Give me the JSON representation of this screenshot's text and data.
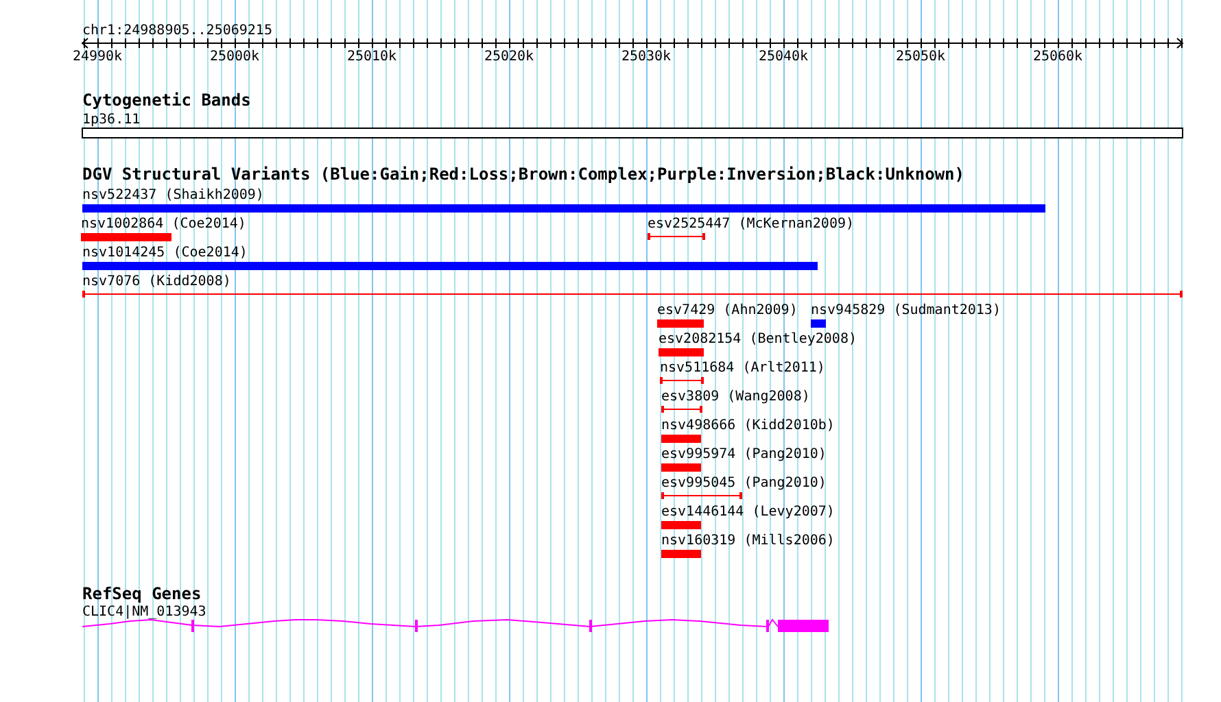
{
  "ruler": {
    "location": "chr1:24988905..25069215",
    "ticks": [
      "24990k",
      "25000k",
      "25010k",
      "25020k",
      "25030k",
      "25040k",
      "25050k",
      "25060k"
    ]
  },
  "tracks": [
    {
      "kind": "bands",
      "title": "Cytogenetic Bands",
      "features": [
        {
          "label": "1p36.11"
        }
      ]
    },
    {
      "kind": "variants",
      "title": "DGV Structural Variants (Blue:Gain;Red:Loss;Brown:Complex;Purple:Inversion;Black:Unknown)",
      "features": [
        {
          "label": "nsv522437 (Shaikh2009)",
          "kind": "gain",
          "thin": false
        },
        {
          "label": "nsv1002864 (Coe2014)",
          "kind": "loss",
          "thin": false
        },
        {
          "label": "esv2525447 (McKernan2009)",
          "kind": "loss",
          "thin": true
        },
        {
          "label": "nsv1014245 (Coe2014)",
          "kind": "gain",
          "thin": false
        },
        {
          "label": "nsv7076 (Kidd2008)",
          "kind": "loss",
          "thin": true
        },
        {
          "label": "esv7429 (Ahn2009)",
          "kind": "loss",
          "thin": false
        },
        {
          "label": "nsv945829 (Sudmant2013)",
          "kind": "gain",
          "thin": false
        },
        {
          "label": "esv2082154 (Bentley2008)",
          "kind": "loss",
          "thin": false
        },
        {
          "label": "nsv511684 (Arlt2011)",
          "kind": "loss",
          "thin": true
        },
        {
          "label": "esv3809 (Wang2008)",
          "kind": "loss",
          "thin": true
        },
        {
          "label": "nsv498666 (Kidd2010b)",
          "kind": "loss",
          "thin": false
        },
        {
          "label": "esv995974 (Pang2010)",
          "kind": "loss",
          "thin": false
        },
        {
          "label": "esv995045 (Pang2010)",
          "kind": "loss",
          "thin": true
        },
        {
          "label": "esv1446144 (Levy2007)",
          "kind": "loss",
          "thin": false
        },
        {
          "label": "nsv160319 (Mills2006)",
          "kind": "loss",
          "thin": false
        }
      ]
    },
    {
      "kind": "genes",
      "title": "RefSeq Genes",
      "features": [
        {
          "label": "CLIC4|NM_013943"
        }
      ]
    }
  ]
}
